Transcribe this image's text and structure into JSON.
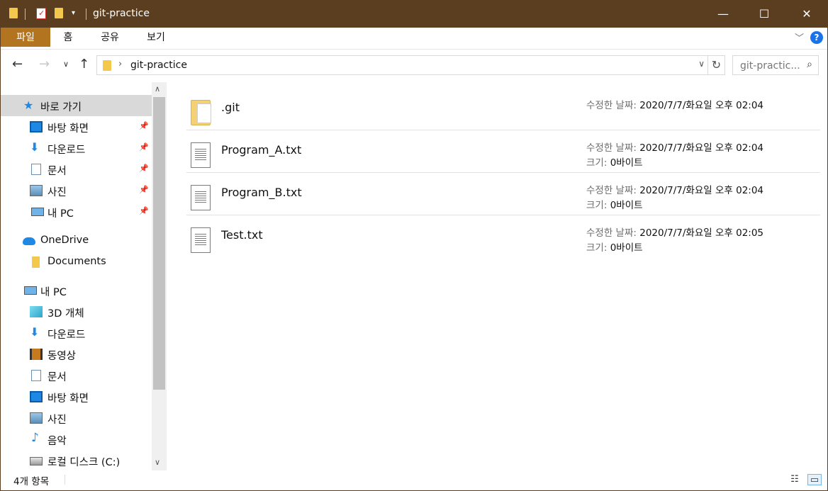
{
  "window": {
    "title": "git-practice"
  },
  "ribbon": {
    "tabs": [
      "파일",
      "홈",
      "공유",
      "보기"
    ]
  },
  "address": {
    "path": "git-practice",
    "search_placeholder": "git-practic..."
  },
  "nav": {
    "items": [
      {
        "label": "바로 가기",
        "icon": "star-icon"
      },
      {
        "label": "바탕 화면",
        "icon": "desktop-icon",
        "pinned": true
      },
      {
        "label": "다운로드",
        "icon": "download-icon",
        "pinned": true
      },
      {
        "label": "문서",
        "icon": "document-icon",
        "pinned": true
      },
      {
        "label": "사진",
        "icon": "picture-icon",
        "pinned": true
      },
      {
        "label": "내 PC",
        "icon": "computer-icon",
        "pinned": true
      },
      {
        "label": "OneDrive",
        "icon": "cloud-icon"
      },
      {
        "label": "Documents",
        "icon": "folder-icon"
      },
      {
        "label": "내 PC",
        "icon": "computer-icon"
      },
      {
        "label": "3D 개체",
        "icon": "cube-icon"
      },
      {
        "label": "다운로드",
        "icon": "download-icon"
      },
      {
        "label": "동영상",
        "icon": "video-icon"
      },
      {
        "label": "문서",
        "icon": "document-icon"
      },
      {
        "label": "바탕 화면",
        "icon": "desktop-icon"
      },
      {
        "label": "사진",
        "icon": "picture-icon"
      },
      {
        "label": "음악",
        "icon": "music-icon"
      },
      {
        "label": "로컬 디스크 (C:)",
        "icon": "drive-icon"
      }
    ]
  },
  "files": [
    {
      "name": ".git",
      "icon": "folder-icon",
      "modified_label": "수정한 날짜:",
      "modified": "2020/7/7/화요일 오후 02:04"
    },
    {
      "name": "Program_A.txt",
      "icon": "text-file-icon",
      "modified_label": "수정한 날짜:",
      "modified": "2020/7/7/화요일 오후 02:04",
      "size_label": "크기:",
      "size": "0바이트"
    },
    {
      "name": "Program_B.txt",
      "icon": "text-file-icon",
      "modified_label": "수정한 날짜:",
      "modified": "2020/7/7/화요일 오후 02:04",
      "size_label": "크기:",
      "size": "0바이트"
    },
    {
      "name": "Test.txt",
      "icon": "text-file-icon",
      "modified_label": "수정한 날짜:",
      "modified": "2020/7/7/화요일 오후 02:05",
      "size_label": "크기:",
      "size": "0바이트"
    }
  ],
  "status": {
    "item_count": "4개 항목"
  },
  "colors": {
    "titlebar": "#5a3e1f",
    "file_tab": "#b37420",
    "accent": "#1a73e8"
  }
}
